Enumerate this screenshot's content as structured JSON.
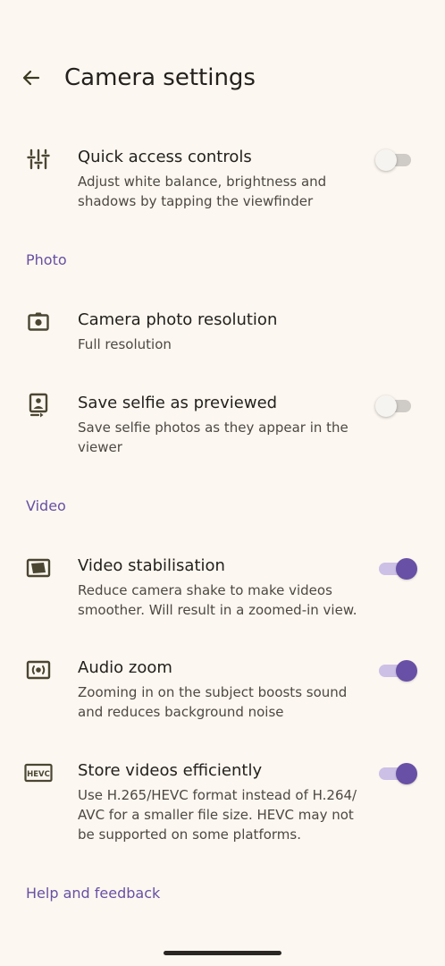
{
  "header": {
    "title": "Camera settings",
    "back_icon": "arrow-back-icon"
  },
  "quick_access": {
    "icon": "sliders-icon",
    "title": "Quick access controls",
    "subtitle": "Adjust white balance, brightness and shadows by tapping the viewfinder",
    "enabled": false
  },
  "photo_section": {
    "label": "Photo",
    "items": [
      {
        "icon": "camera-icon",
        "title": "Camera photo resolution",
        "subtitle": "Full resolution"
      },
      {
        "icon": "selfie-portrait-icon",
        "title": "Save selfie as previewed",
        "subtitle": "Save selfie photos as they appear in the viewer",
        "enabled": false
      }
    ]
  },
  "video_section": {
    "label": "Video",
    "items": [
      {
        "icon": "video-stabilisation-icon",
        "title": "Video stabilisation",
        "subtitle": "Reduce camera shake to make videos smoother. Will result in a zoomed-in view.",
        "enabled": true
      },
      {
        "icon": "audio-zoom-icon",
        "title": "Audio zoom",
        "subtitle": "Zooming in on the subject boosts sound and reduces background noise",
        "enabled": true
      },
      {
        "icon": "hevc-icon",
        "icon_text": "HEVC",
        "title": "Store videos efficiently",
        "subtitle": "Use H.265/HEVC format instead of H.264/ AVC for a smaller file size. HEVC may not be supported on some platforms.",
        "enabled": true
      }
    ]
  },
  "help": {
    "label": "Help and feedback"
  },
  "colors": {
    "background": "#fcf7f0",
    "accent": "#6750a4",
    "toggle_on_thumb": "#6850a6",
    "toggle_on_track": "#cdc0e6",
    "toggle_off_track": "#cfcbc6",
    "icon": "#4a4632"
  }
}
